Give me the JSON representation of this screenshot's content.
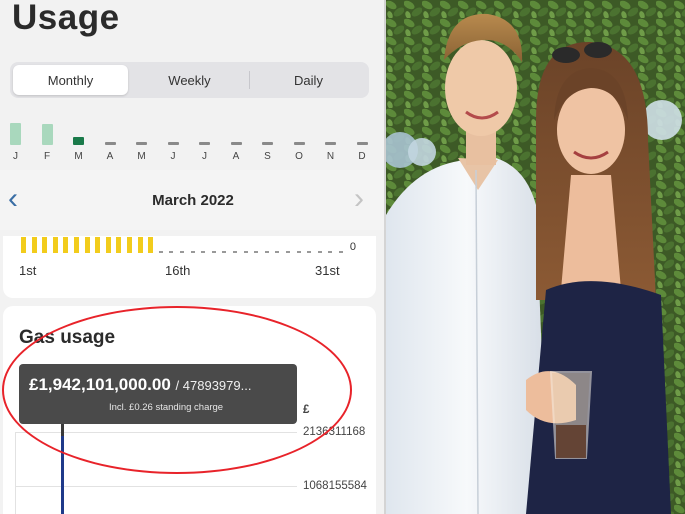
{
  "app": {
    "title": "Usage"
  },
  "period_tabs": [
    {
      "label": "Monthly",
      "active": true
    },
    {
      "label": "Weekly",
      "active": false
    },
    {
      "label": "Daily",
      "active": false
    }
  ],
  "monthly_chart": {
    "months": [
      "J",
      "F",
      "M",
      "A",
      "M",
      "J",
      "J",
      "A",
      "S",
      "O",
      "N",
      "D"
    ],
    "levels": [
      1,
      0.95,
      0.35,
      0,
      0,
      0,
      0,
      0,
      0,
      0,
      0,
      0
    ],
    "selected_index": 2,
    "colors": {
      "past": "#a9d8bd",
      "selected": "#1a7a4a",
      "empty": "#8a8a8a"
    }
  },
  "month_nav": {
    "title": "March 2022",
    "prev_icon": "chevron-left-icon",
    "next_icon": "chevron-right-icon"
  },
  "daily_chart": {
    "zero_label": "0",
    "ticks": [
      "1st",
      "16th",
      "31st"
    ],
    "filled_days": 13,
    "total_days": 31,
    "bar_color": "#f2cc1c"
  },
  "gas_usage": {
    "title": "Gas usage",
    "tooltip": {
      "amount": "£1,942,101,000.00",
      "usage": "/ 47893979...",
      "note": "Incl. £0.26 standing charge"
    },
    "axis": {
      "unit": "£",
      "labels": [
        "2136311168",
        "1068155584"
      ]
    },
    "line_color": "#1f3a8a"
  },
  "annotation": {
    "color": "#e8232a"
  }
}
